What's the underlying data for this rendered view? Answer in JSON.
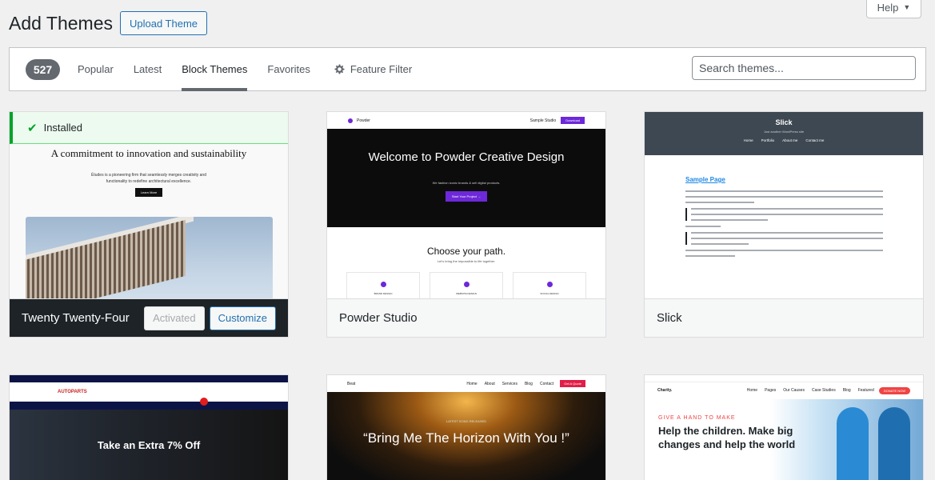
{
  "header": {
    "title": "Add Themes",
    "upload_label": "Upload Theme",
    "help_label": "Help"
  },
  "filter": {
    "count": "527",
    "tabs": [
      {
        "label": "Popular"
      },
      {
        "label": "Latest"
      },
      {
        "label": "Block Themes",
        "active": true
      },
      {
        "label": "Favorites"
      }
    ],
    "feature_filter_label": "Feature Filter",
    "search_placeholder": "Search themes..."
  },
  "themes": [
    {
      "name": "Twenty Twenty-Four",
      "installed_label": "Installed",
      "activated_label": "Activated",
      "customize_label": "Customize",
      "preview": {
        "heading": "A commitment to innovation and sustainability",
        "text": "Études is a pioneering firm that seamlessly merges creativity and functionality to redefine architectural excellence.",
        "button": "Learn More"
      }
    },
    {
      "name": "Powder Studio",
      "preview": {
        "brand": "Powder",
        "nav": "Sample   Studio",
        "download": "Download",
        "heading": "Welcome to Powder Creative Design",
        "sub": "We fashion iconic brands & sell digital products.",
        "button": "Start Your Project →",
        "heading2": "Choose your path.",
        "sub2": "Let's bring the impossible to life together.",
        "boxes": [
          "BRAND DESIGN",
          "WEBSITE DESIGN",
          "SOCIAL DESIGN"
        ]
      }
    },
    {
      "name": "Slick",
      "preview": {
        "site": "Slick",
        "tagline": "Just another WordPress site",
        "menu": [
          "Home",
          "Portfolio",
          "About me",
          "Contact me"
        ],
        "page_title": "Sample Page"
      }
    },
    {
      "name": "",
      "preview": {
        "logo": "AUTOPARTS",
        "headline": "Take an Extra 7% Off"
      }
    },
    {
      "name": "",
      "preview": {
        "brand": "Beat",
        "menu": [
          "Home",
          "About",
          "Services",
          "Blog",
          "Contact"
        ],
        "quote": "Get A Quote",
        "kicker": "LATEST SONG RELEASED",
        "headline": "“Bring Me The Horizon With You !”"
      }
    },
    {
      "name": "",
      "preview": {
        "brand": "Charity.",
        "menu": [
          "Home",
          "Pages",
          "Our Causes",
          "Case Studies",
          "Blog",
          "Featured"
        ],
        "donate": "DONATE NOW",
        "kicker": "GIVE A HAND TO MAKE",
        "headline": "Help the children. Make big changes and help the world"
      }
    }
  ],
  "colors": {
    "accent": "#2271b1",
    "installed_green": "#00a32a",
    "dark": "#1d2327"
  }
}
